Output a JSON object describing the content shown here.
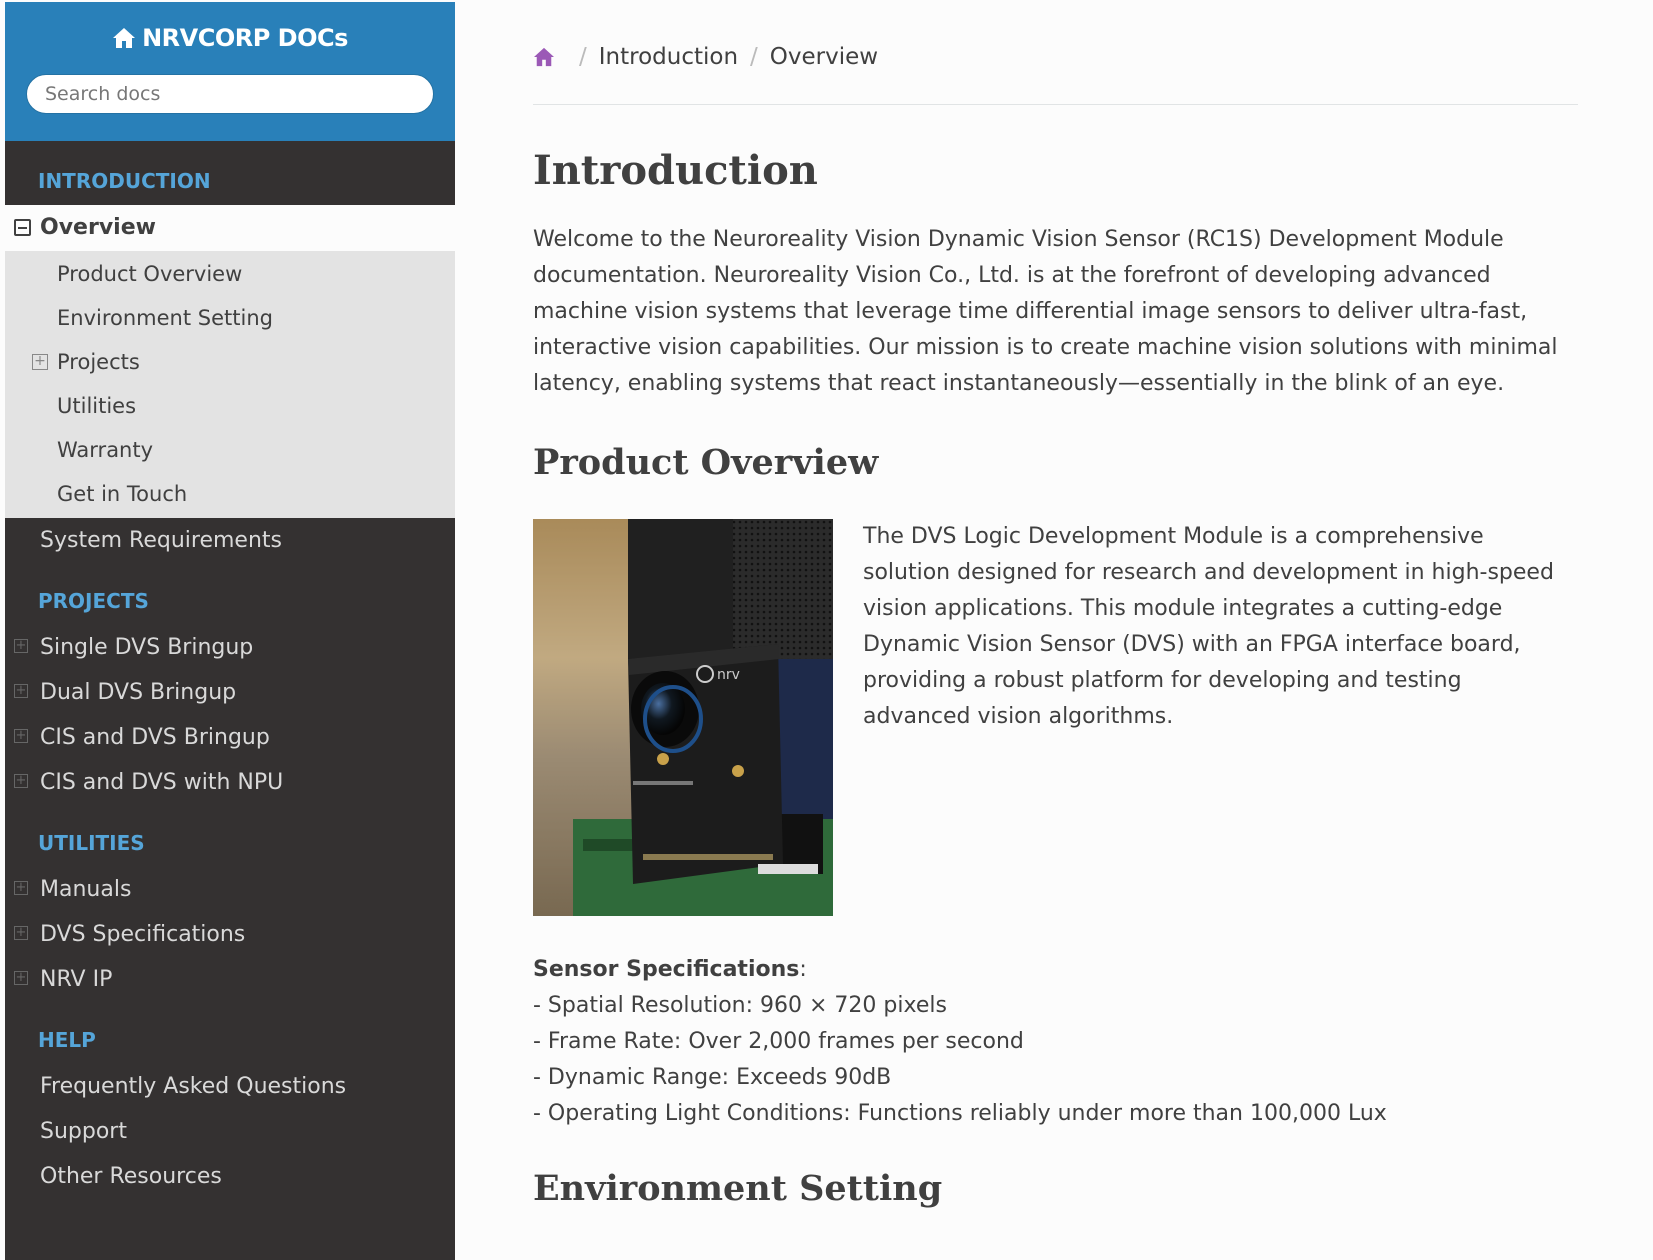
{
  "sidebar": {
    "brand": "NRVCORP DOCs",
    "search_placeholder": "Search docs",
    "sections": {
      "introduction": "INTRODUCTION",
      "projects": "PROJECTS",
      "utilities": "UTILITIES",
      "help": "HELP"
    },
    "current": "Overview",
    "current_sub": [
      "Product Overview",
      "Environment Setting",
      "Projects",
      "Utilities",
      "Warranty",
      "Get in Touch"
    ],
    "system_requirements": "System Requirements",
    "projects": [
      "Single DVS Bringup",
      "Dual DVS Bringup",
      "CIS and DVS Bringup",
      "CIS and DVS with NPU"
    ],
    "utilities": [
      "Manuals",
      "DVS Specifications",
      "NRV IP"
    ],
    "help": [
      "Frequently Asked Questions",
      "Support",
      "Other Resources"
    ]
  },
  "breadcrumb": {
    "items": [
      "Introduction",
      "Overview"
    ],
    "separator": "/"
  },
  "content": {
    "title": "Introduction",
    "intro": "Welcome to the Neuroreality Vision Dynamic Vision Sensor (RC1S) Development Module documentation. Neuroreality Vision Co., Ltd. is at the forefront of developing advanced machine vision systems that leverage time differential image sensors to deliver ultra-fast, interactive vision capabilities. Our mission is to create machine vision solutions with minimal latency, enabling systems that react instantaneously—essentially in the blink of an eye.",
    "product_heading": "Product Overview",
    "product_text": "The DVS Logic Development Module is a comprehensive solution designed for research and development in high-speed vision applications. This module integrates a cutting-edge Dynamic Vision Sensor (DVS) with an FPGA interface board, providing a robust platform for developing and testing advanced vision algorithms.",
    "image_label": "nrv",
    "specs_heading": "Sensor Specifications",
    "specs_colon": ":",
    "specs": [
      "- Spatial Resolution: 960 × 720 pixels",
      "- Frame Rate: Over 2,000 frames per second",
      "- Dynamic Range: Exceeds 90dB",
      "- Operating Light Conditions: Functions reliably under more than 100,000 Lux"
    ],
    "env_heading": "Environment Setting"
  },
  "colors": {
    "sidebar_bg": "#343131",
    "header_blue": "#2980b9",
    "caption_blue": "#55a5d9",
    "home_icon": "#9b59b6"
  }
}
